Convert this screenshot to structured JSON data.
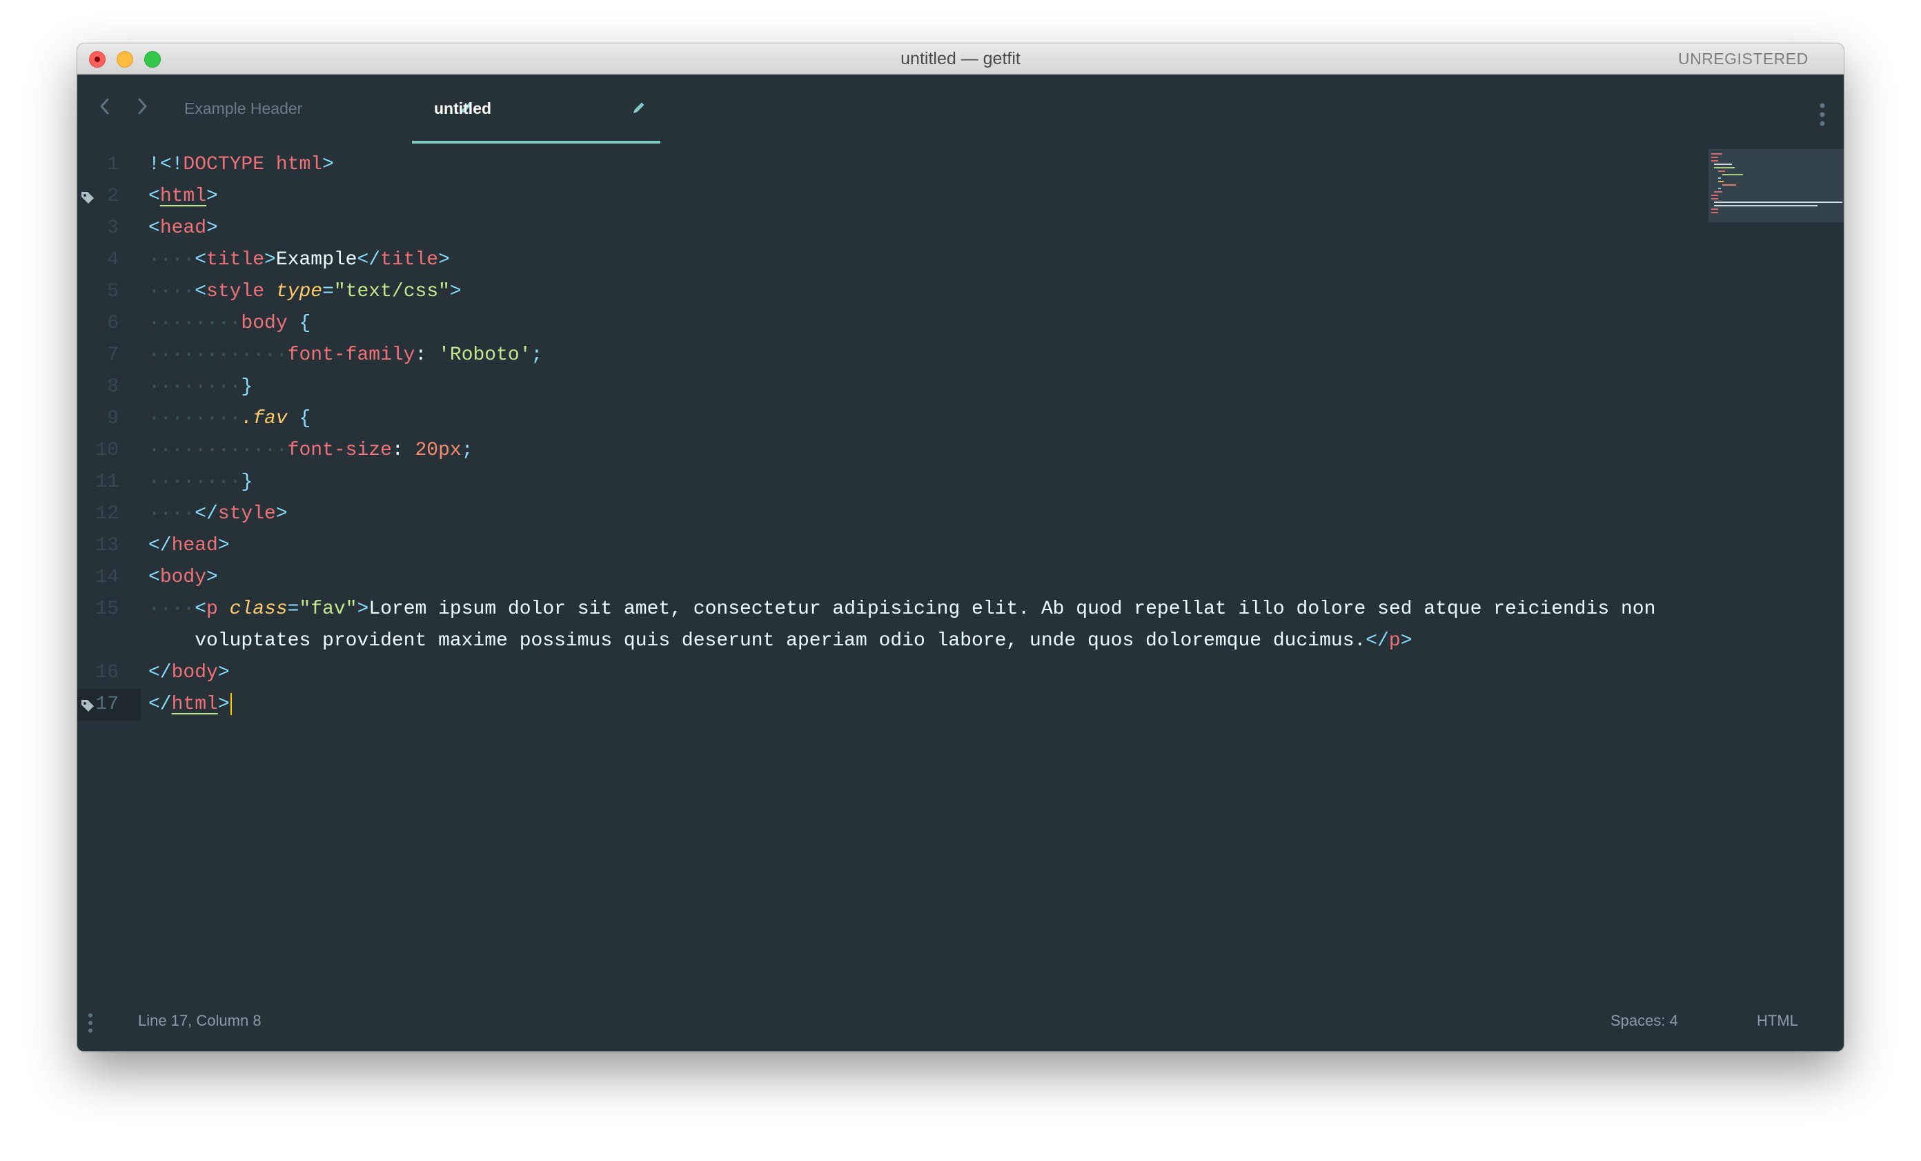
{
  "window": {
    "title": "untitled — getfit",
    "badge": "UNREGISTERED",
    "traffic_lights": [
      "close",
      "minimize",
      "zoom"
    ]
  },
  "tabs": [
    {
      "label": "Example Header",
      "active": false,
      "icon": "pencil-icon"
    },
    {
      "label": "untitled",
      "active": true,
      "icon": "pencil-icon"
    }
  ],
  "navigation": {
    "back_icon": "chevron-left-icon",
    "forward_icon": "chevron-right-icon",
    "menu_icon": "vertical-dots-icon"
  },
  "editor": {
    "line_numbers": [
      "1",
      "2",
      "3",
      "4",
      "5",
      "6",
      "7",
      "8",
      "9",
      "10",
      "11",
      "12",
      "13",
      "14",
      "15",
      "",
      "16",
      "17"
    ],
    "lines": [
      {
        "g": "····",
        "parts": []
      },
      {
        "parts": [
          [
            "!",
            "t-punct"
          ],
          [
            "<!",
            "t-punct"
          ],
          [
            "DOCTYPE",
            "t-tag"
          ],
          [
            " html",
            "t-tag"
          ],
          [
            ">",
            "t-punct"
          ]
        ]
      },
      {
        "parts": [
          [
            "<",
            "t-punct"
          ],
          [
            "html",
            "t-tag ul"
          ],
          [
            ">",
            "t-punct"
          ]
        ]
      },
      {
        "parts": [
          [
            "<",
            "t-punct"
          ],
          [
            "head",
            "t-tag"
          ],
          [
            ">",
            "t-punct"
          ]
        ]
      },
      {
        "parts": [
          [
            "····",
            "guide"
          ],
          [
            "<",
            "t-punct"
          ],
          [
            "title",
            "t-tag"
          ],
          [
            ">",
            "t-punct"
          ],
          [
            "Example",
            ""
          ],
          [
            "</",
            "t-punct"
          ],
          [
            "title",
            "t-tag"
          ],
          [
            ">",
            "t-punct"
          ]
        ]
      },
      {
        "parts": [
          [
            "····",
            "guide"
          ],
          [
            "<",
            "t-punct"
          ],
          [
            "style",
            "t-tag"
          ],
          [
            " ",
            ""
          ],
          [
            "type",
            "t-attr"
          ],
          [
            "=",
            "t-punct"
          ],
          [
            "\"text/css\"",
            "t-str"
          ],
          [
            ">",
            "t-punct"
          ]
        ]
      },
      {
        "parts": [
          [
            "········",
            "guide"
          ],
          [
            "body",
            "t-tag"
          ],
          [
            " ",
            ""
          ],
          [
            "{",
            "t-punct"
          ]
        ]
      },
      {
        "parts": [
          [
            "············",
            "guide"
          ],
          [
            "font-family",
            "t-tag"
          ],
          [
            ": ",
            ""
          ],
          [
            "'Roboto'",
            "t-str"
          ],
          [
            ";",
            "t-punct"
          ]
        ]
      },
      {
        "parts": [
          [
            "········",
            "guide"
          ],
          [
            "}",
            "t-punct"
          ]
        ]
      },
      {
        "parts": [
          [
            "········",
            "guide"
          ],
          [
            ".fav",
            "t-cls"
          ],
          [
            " ",
            ""
          ],
          [
            "{",
            "t-punct"
          ]
        ]
      },
      {
        "parts": [
          [
            "············",
            "guide"
          ],
          [
            "font-size",
            "t-tag"
          ],
          [
            ": ",
            ""
          ],
          [
            "20px",
            "t-num"
          ],
          [
            ";",
            "t-punct"
          ]
        ]
      },
      {
        "parts": [
          [
            "········",
            "guide"
          ],
          [
            "}",
            "t-punct"
          ]
        ]
      },
      {
        "parts": [
          [
            "····",
            "guide"
          ],
          [
            "</",
            "t-punct"
          ],
          [
            "style",
            "t-tag"
          ],
          [
            ">",
            "t-punct"
          ]
        ]
      },
      {
        "parts": [
          [
            "</",
            "t-punct"
          ],
          [
            "head",
            "t-tag"
          ],
          [
            ">",
            "t-punct"
          ]
        ]
      },
      {
        "parts": [
          [
            "<",
            "t-punct"
          ],
          [
            "body",
            "t-tag"
          ],
          [
            ">",
            "t-punct"
          ]
        ]
      },
      {
        "parts": [
          [
            "····",
            "guide"
          ],
          [
            "<",
            "t-punct"
          ],
          [
            "p",
            "t-tag"
          ],
          [
            " ",
            ""
          ],
          [
            "class",
            "t-attr"
          ],
          [
            "=",
            "t-punct"
          ],
          [
            "\"fav\"",
            "t-str"
          ],
          [
            ">",
            "t-punct"
          ],
          [
            "Lorem ipsum dolor sit amet, consectetur adipisicing elit. Ab quod repellat illo dolore sed atque reiciendis non",
            ""
          ]
        ]
      },
      {
        "parts": [
          [
            "    ",
            ""
          ],
          [
            "voluptates provident maxime possimus quis deserunt aperiam odio labore, unde quos doloremque ducimus.",
            ""
          ],
          [
            "</",
            "t-punct"
          ],
          [
            "p",
            "t-tag"
          ],
          [
            ">",
            "t-punct"
          ]
        ]
      },
      {
        "parts": [
          [
            "</",
            "t-punct"
          ],
          [
            "body",
            "t-tag"
          ],
          [
            ">",
            "t-punct"
          ]
        ]
      },
      {
        "parts": [
          [
            "</",
            "t-punct"
          ],
          [
            "html",
            "t-tag ul"
          ],
          [
            ">",
            "t-punct"
          ]
        ]
      }
    ],
    "bookmarked_lines": [
      "2",
      "17"
    ],
    "current_line": "17",
    "minimap_icon": "minimap-preview"
  },
  "statusbar": {
    "position": "Line 17, Column 8",
    "indentation": "Spaces: 4",
    "syntax": "HTML",
    "menu_icon": "vertical-dots-icon"
  },
  "colors": {
    "background": "#263238",
    "tag": "#f07178",
    "punctuation": "#89ddff",
    "attribute": "#ffcb6b",
    "string": "#c3e88d",
    "number": "#f78c6c",
    "accent": "#80cbc4",
    "caret": "#ffcc00"
  }
}
